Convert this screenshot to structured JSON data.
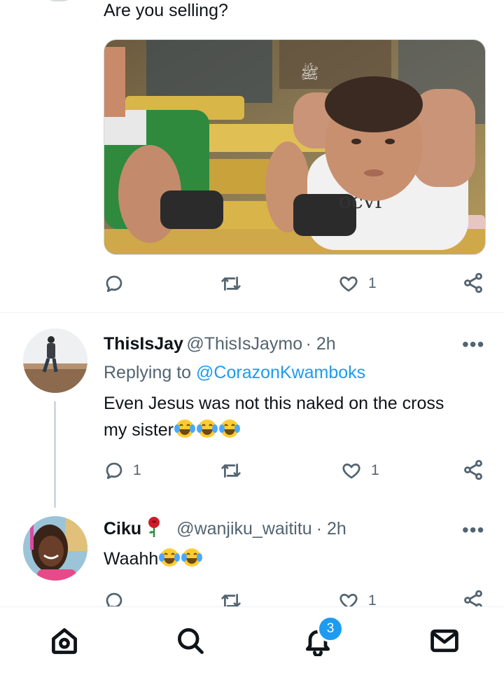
{
  "tweet1": {
    "text": "Are you selling?",
    "actions": {
      "reply_count": "",
      "retweet_count": "",
      "like_count": "1"
    }
  },
  "tweet2": {
    "name": "ThisIsJay",
    "handle": "@ThisIsJaymo",
    "time": "· 2h",
    "replying_prefix": "Replying to",
    "replying_to": "@CorazonKwamboks",
    "text_line1": "Even Jesus was not this naked on the cross",
    "text_line2": "my sister",
    "actions": {
      "reply_count": "1",
      "retweet_count": "",
      "like_count": "1"
    }
  },
  "tweet3": {
    "name": "Ciku",
    "handle": "@wanjiku_waititu",
    "time": "· 2h",
    "text": "Waahh",
    "actions": {
      "reply_count": "",
      "retweet_count": "",
      "like_count": "1"
    }
  },
  "navbar": {
    "notifications_badge": "3"
  },
  "colors": {
    "accent": "#1d9bf0",
    "muted": "#536471",
    "text": "#0f1419"
  }
}
